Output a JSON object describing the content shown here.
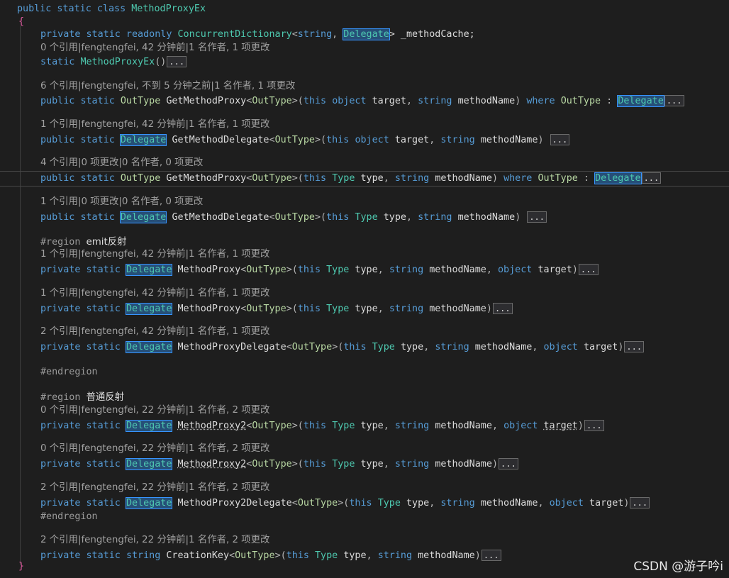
{
  "class_decl": {
    "kw1": "public static class ",
    "name": "MethodProxyEx"
  },
  "open_brace": "{",
  "close_brace": "}",
  "field": {
    "mods": "private static readonly ",
    "type": "ConcurrentDictionary",
    "lt": "<",
    "t1": "string",
    "comma": ", ",
    "t2": "Delegate",
    "rest": "> _methodCache;"
  },
  "lenses": [
    "0 个引用|fengtengfei, 42 分钟前|1 名作者, 1 项更改",
    "6 个引用|fengtengfei, 不到 5 分钟之前|1 名作者, 1 项更改",
    "1 个引用|fengtengfei, 42 分钟前|1 名作者, 1 项更改",
    "4 个引用|0 项更改|0 名作者, 0 项更改",
    "1 个引用|0 项更改|0 名作者, 0 项更改",
    "1 个引用|fengtengfei, 42 分钟前|1 名作者, 1 项更改",
    "1 个引用|fengtengfei, 42 分钟前|1 名作者, 1 项更改",
    "2 个引用|fengtengfei, 42 分钟前|1 名作者, 1 项更改",
    "0 个引用|fengtengfei, 22 分钟前|1 名作者, 2 项更改",
    "0 个引用|fengtengfei, 22 分钟前|1 名作者, 2 项更改",
    "2 个引用|fengtengfei, 22 分钟前|1 名作者, 2 项更改",
    "2 个引用|fengtengfei, 22 分钟前|1 名作者, 2 项更改"
  ],
  "ctor": {
    "kw": "static ",
    "name": "MethodProxyEx",
    "parens": "()"
  },
  "collapsed": "...",
  "tokens": {
    "public": "public",
    "private": "private",
    "static": "static",
    "OutType": "OutType",
    "Delegate": "Delegate",
    "this": "this",
    "object": "object",
    "string": "string",
    "Type": "Type",
    "where": "where",
    "target": "target",
    "methodName": "methodName",
    "type": "type"
  },
  "methods": {
    "GetMethodProxy": "GetMethodProxy",
    "GetMethodDelegate": "GetMethodDelegate",
    "MethodProxy": "MethodProxy",
    "MethodProxyDelegate": "MethodProxyDelegate",
    "MethodProxy2": "MethodProxy2",
    "MethodProxy2Delegate": "MethodProxy2Delegate",
    "CreationKey": "CreationKey"
  },
  "regions": {
    "r1_kw": "#region ",
    "r1_name": "emit反射",
    "r2_kw": "#region ",
    "r2_name": "普通反射",
    "end": "#endregion"
  },
  "watermark": "CSDN @游子吟i"
}
